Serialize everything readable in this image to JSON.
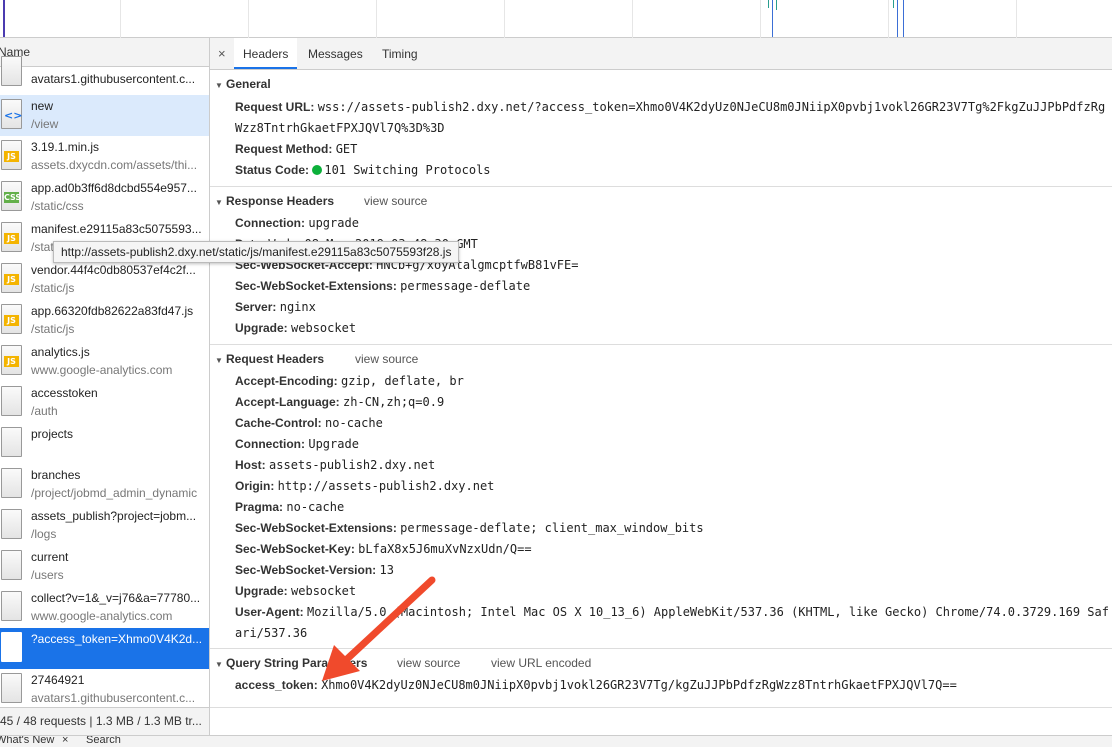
{
  "left_panel": {
    "header": "Name",
    "requests": [
      {
        "name": "avatars1.githubusercontent.c...",
        "path": "",
        "type": "blank",
        "state": "normal"
      },
      {
        "name": "new",
        "path": "/view",
        "type": "doc",
        "state": "selected-light"
      },
      {
        "name": "3.19.1.min.js",
        "path": "assets.dxycdn.com/assets/thi...",
        "type": "js",
        "state": "normal"
      },
      {
        "name": "app.ad0b3ff6d8dcbd554e957...",
        "path": "/static/css",
        "type": "css",
        "state": "normal"
      },
      {
        "name": "manifest.e29115a83c5075593...",
        "path": "/stat",
        "type": "js",
        "state": "normal"
      },
      {
        "name": "vendor.44f4c0db80537ef4c2f...",
        "path": "/static/js",
        "type": "js",
        "state": "normal"
      },
      {
        "name": "app.66320fdb82622a83fd47.js",
        "path": "/static/js",
        "type": "js",
        "state": "normal"
      },
      {
        "name": "analytics.js",
        "path": "www.google-analytics.com",
        "type": "js",
        "state": "normal"
      },
      {
        "name": "accesstoken",
        "path": "/auth",
        "type": "blank",
        "state": "normal"
      },
      {
        "name": "projects",
        "path": "",
        "type": "blank",
        "state": "normal"
      },
      {
        "name": "branches",
        "path": "/project/jobmd_admin_dynamic",
        "type": "blank",
        "state": "normal"
      },
      {
        "name": "assets_publish?project=jobm...",
        "path": "/logs",
        "type": "blank",
        "state": "normal"
      },
      {
        "name": "current",
        "path": "/users",
        "type": "blank",
        "state": "normal"
      },
      {
        "name": "collect?v=1&_v=j76&a=77780...",
        "path": "www.google-analytics.com",
        "type": "blank",
        "state": "normal"
      },
      {
        "name": "?access_token=Xhmo0V4K2d...",
        "path": "",
        "type": "blank",
        "state": "selected"
      },
      {
        "name": "27464921",
        "path": "avatars1.githubusercontent.c...",
        "type": "blank",
        "state": "normal"
      }
    ],
    "footer": "45 / 48 requests | 1.3 MB / 1.3 MB tr..."
  },
  "tooltip": "http://assets-publish2.dxy.net/static/js/manifest.e29115a83c5075593f28.js",
  "tabs": {
    "close": "×",
    "items": [
      "Headers",
      "Messages",
      "Timing"
    ],
    "active": "Headers"
  },
  "general": {
    "title": "General",
    "request_url_key": "Request URL:",
    "request_url_line1": "wss://assets-publish2.dxy.net/?access_token=Xhmo0V4K2dyUz0NJeCU8m0JNiipX0pvbj1vokl26GR23V7Tg%2FkgZuJJPbPdfzRg",
    "request_url_line2": "Wzz8TntrhGkaetFPXJQVl7Q%3D%3D",
    "request_method_key": "Request Method:",
    "request_method": "GET",
    "status_code_key": "Status Code:",
    "status_code": "101 Switching Protocols",
    "status_color": "#0cb03a"
  },
  "response_headers": {
    "title": "Response Headers",
    "view_source": "view source",
    "rows": [
      {
        "k": "Connection:",
        "v": "upgrade"
      },
      {
        "k": "Date:",
        "v": "Wed, 08 May 2019 03:48:30 GMT"
      },
      {
        "k": "Sec-WebSocket-Accept:",
        "v": "HNCb+g/xoyAtalgmcptfwB81vFE="
      },
      {
        "k": "Sec-WebSocket-Extensions:",
        "v": "permessage-deflate"
      },
      {
        "k": "Server:",
        "v": "nginx"
      },
      {
        "k": "Upgrade:",
        "v": "websocket"
      }
    ]
  },
  "request_headers": {
    "title": "Request Headers",
    "view_source": "view source",
    "rows": [
      {
        "k": "Accept-Encoding:",
        "v": "gzip, deflate, br"
      },
      {
        "k": "Accept-Language:",
        "v": "zh-CN,zh;q=0.9"
      },
      {
        "k": "Cache-Control:",
        "v": "no-cache"
      },
      {
        "k": "Connection:",
        "v": "Upgrade"
      },
      {
        "k": "Host:",
        "v": "assets-publish2.dxy.net"
      },
      {
        "k": "Origin:",
        "v": "http://assets-publish2.dxy.net"
      },
      {
        "k": "Pragma:",
        "v": "no-cache"
      },
      {
        "k": "Sec-WebSocket-Extensions:",
        "v": "permessage-deflate; client_max_window_bits"
      },
      {
        "k": "Sec-WebSocket-Key:",
        "v": "bLfaX8x5J6muXvNzxUdn/Q=="
      },
      {
        "k": "Sec-WebSocket-Version:",
        "v": "13"
      },
      {
        "k": "Upgrade:",
        "v": "websocket"
      },
      {
        "k": "User-Agent:",
        "v": "Mozilla/5.0 (Macintosh; Intel Mac OS X 10_13_6) AppleWebKit/537.36 (KHTML, like Gecko) Chrome/74.0.3729.169 Saf"
      }
    ],
    "user_agent_cont": "ari/537.36"
  },
  "query_string": {
    "title": "Query String Parameters",
    "view_source": "view source",
    "view_url_encoded": "view URL encoded",
    "key": "access_token:",
    "value": "Xhmo0V4K2dyUz0NJeCU8m0JNiipX0pvbj1vokl26GR23V7Tg/kgZuJJPbPdfzRgWzz8TntrhGkaetFPXJQVl7Q=="
  },
  "drawer": {
    "tab1": "What's New",
    "tab1_close": "×",
    "tab2": "Search"
  },
  "colors": {
    "accent": "#1a73e8",
    "annotation_arrow": "#f04a2c"
  }
}
